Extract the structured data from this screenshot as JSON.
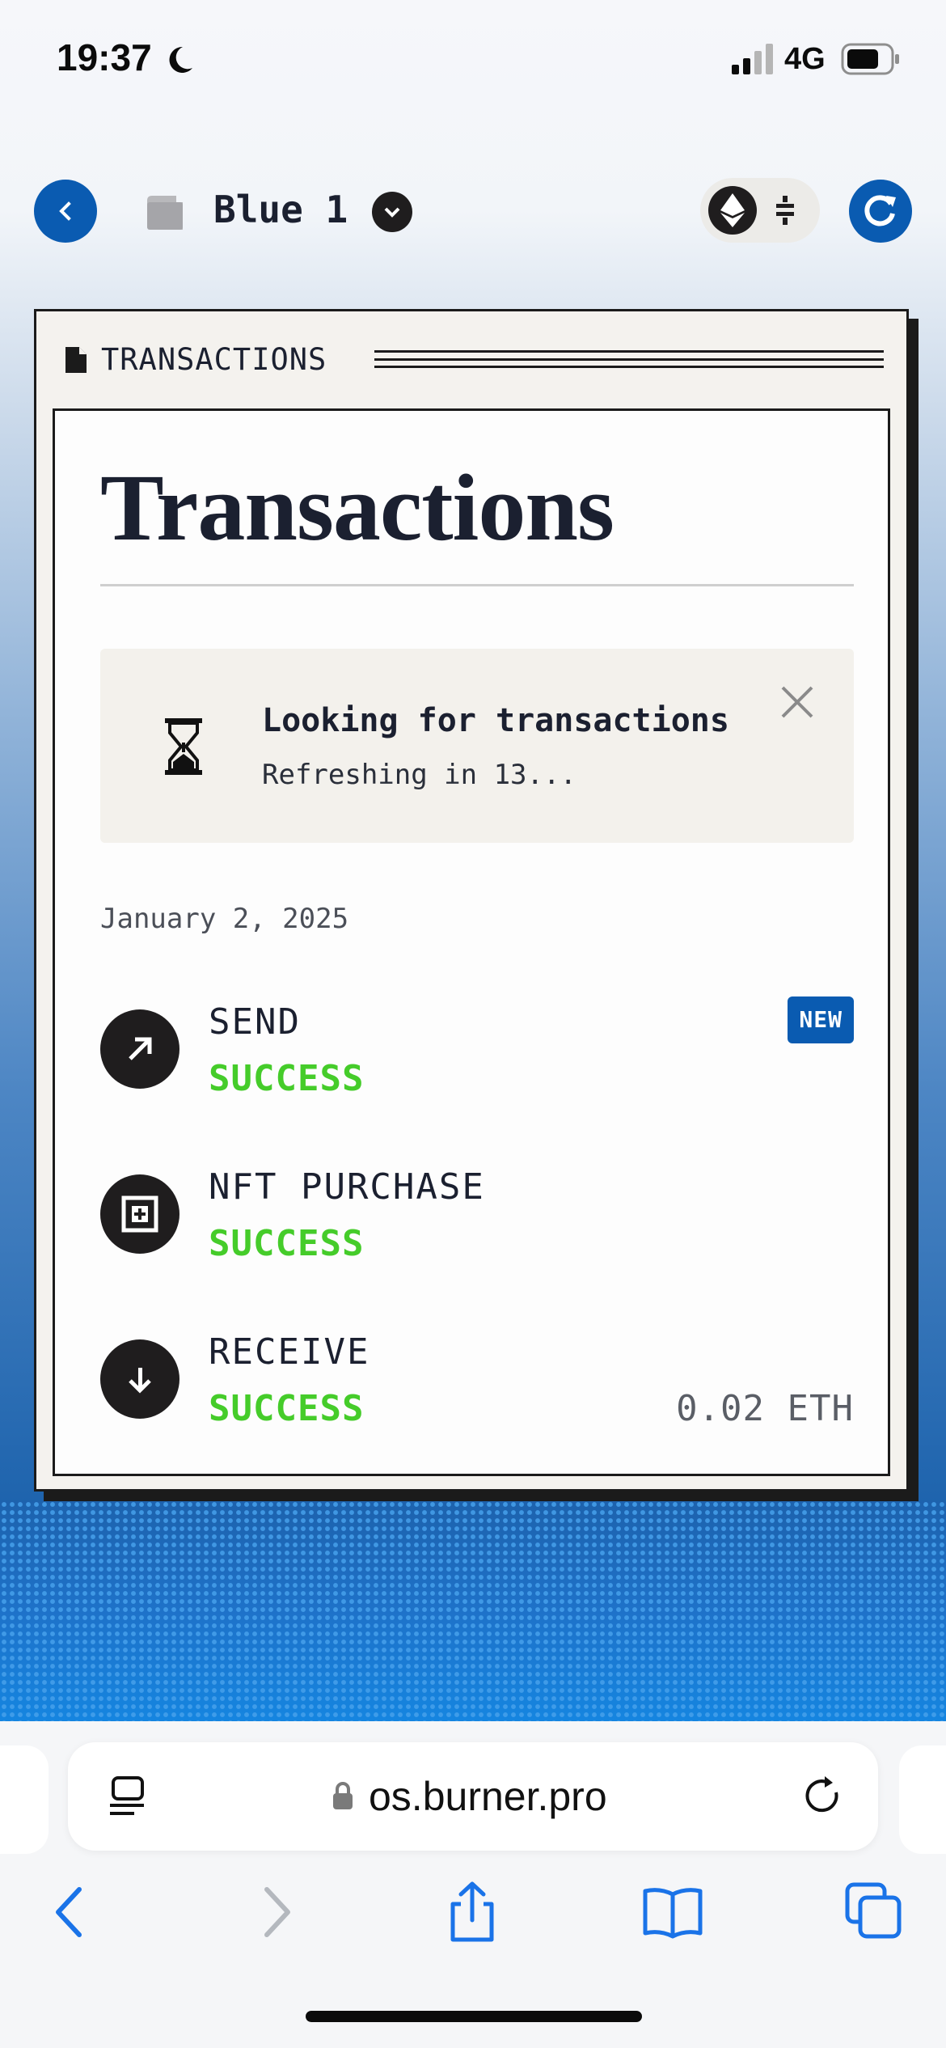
{
  "status_bar": {
    "time": "19:37",
    "network": "4G",
    "icons": [
      "moon-icon",
      "signal-icon",
      "battery-icon"
    ]
  },
  "app_bar": {
    "wallet_name": "Blue 1",
    "icons": [
      "back-arrow-icon",
      "wallet-icon",
      "chevron-down-icon",
      "eth-icon",
      "swap-icon",
      "refresh-icon"
    ],
    "accent_color": "#0a5bb1"
  },
  "card": {
    "header_label": "TRANSACTIONS",
    "page_title": "Transactions",
    "loading": {
      "title": "Looking for transactions",
      "subtitle": "Refreshing in 13..."
    },
    "date": "January 2, 2025",
    "transactions": [
      {
        "type": "SEND",
        "status": "SUCCESS",
        "badge": "NEW",
        "amount": "",
        "icon": "arrow-up-right-icon"
      },
      {
        "type": "NFT PURCHASE",
        "status": "SUCCESS",
        "badge": "",
        "amount": "",
        "icon": "nft-icon"
      },
      {
        "type": "RECEIVE",
        "status": "SUCCESS",
        "badge": "",
        "amount": "0.02 ETH",
        "icon": "arrow-down-icon"
      }
    ],
    "status_color": "#45cc2a"
  },
  "browser": {
    "url": "os.burner.pro",
    "toolbar": [
      "back-icon",
      "forward-icon",
      "share-icon",
      "bookmarks-icon",
      "tabs-icon"
    ]
  }
}
